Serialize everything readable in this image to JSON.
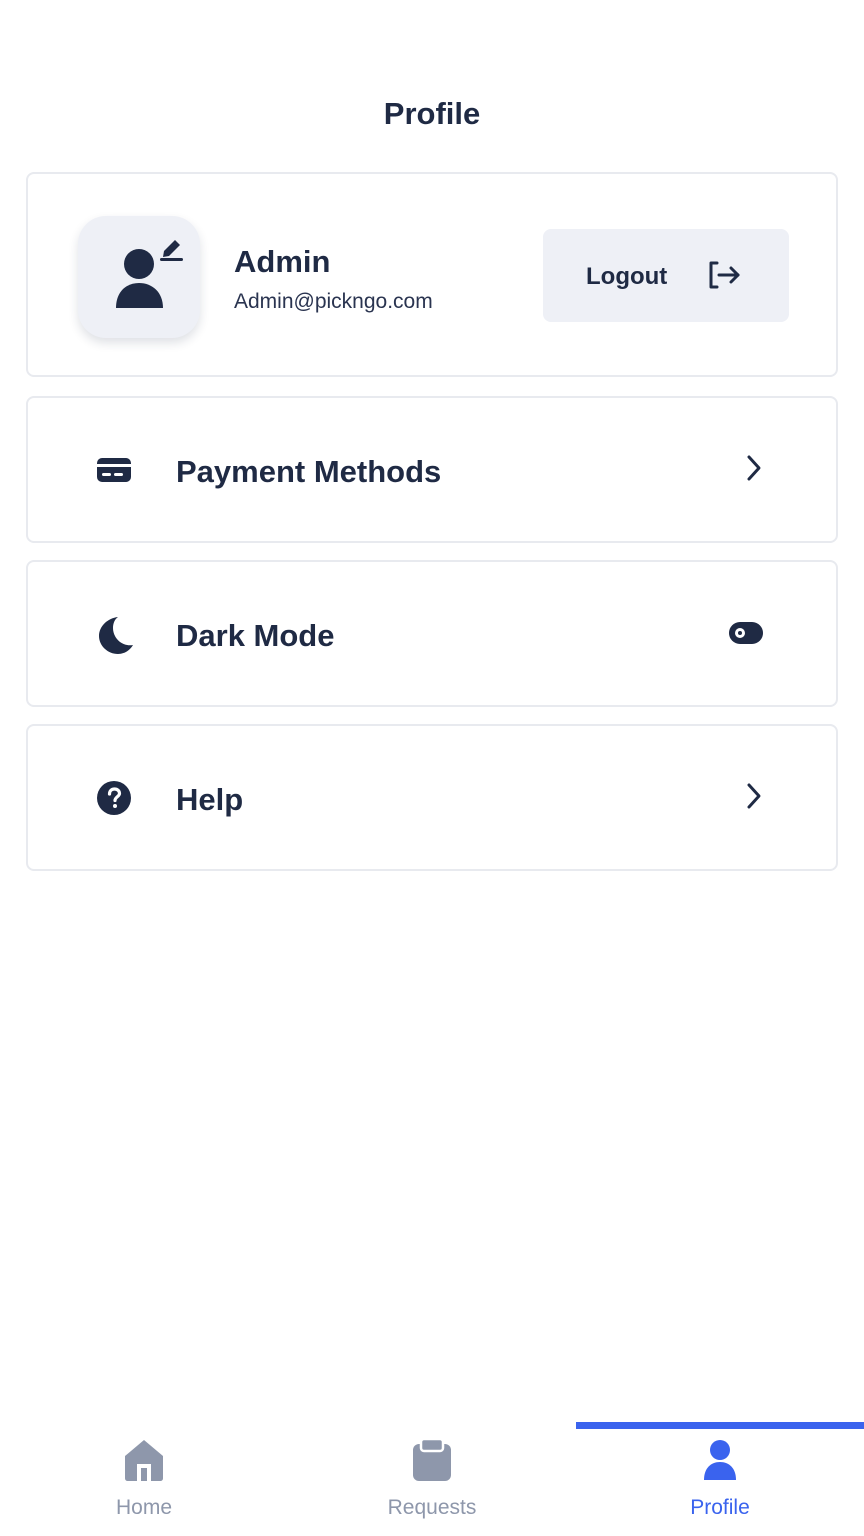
{
  "header": {
    "title": "Profile"
  },
  "profile": {
    "name": "Admin",
    "email": "Admin@pickngo.com",
    "logout_label": "Logout"
  },
  "menu": {
    "items": [
      {
        "label": "Payment Methods",
        "icon": "credit-card-icon",
        "right": "chevron-right-icon"
      },
      {
        "label": "Dark Mode",
        "icon": "moon-icon",
        "right": "toggle-switch",
        "toggle_on": false
      },
      {
        "label": "Help",
        "icon": "help-circle-icon",
        "right": "chevron-right-icon"
      }
    ]
  },
  "bottom_nav": {
    "items": [
      {
        "label": "Home",
        "icon": "home-icon",
        "active": false
      },
      {
        "label": "Requests",
        "icon": "clipboard-icon",
        "active": false
      },
      {
        "label": "Profile",
        "icon": "user-icon",
        "active": true
      }
    ]
  },
  "colors": {
    "text_primary": "#1f2a44",
    "accent": "#3a63ee",
    "inactive": "#8e97ab",
    "surface": "#eef0f6",
    "border": "#e8eaef"
  }
}
